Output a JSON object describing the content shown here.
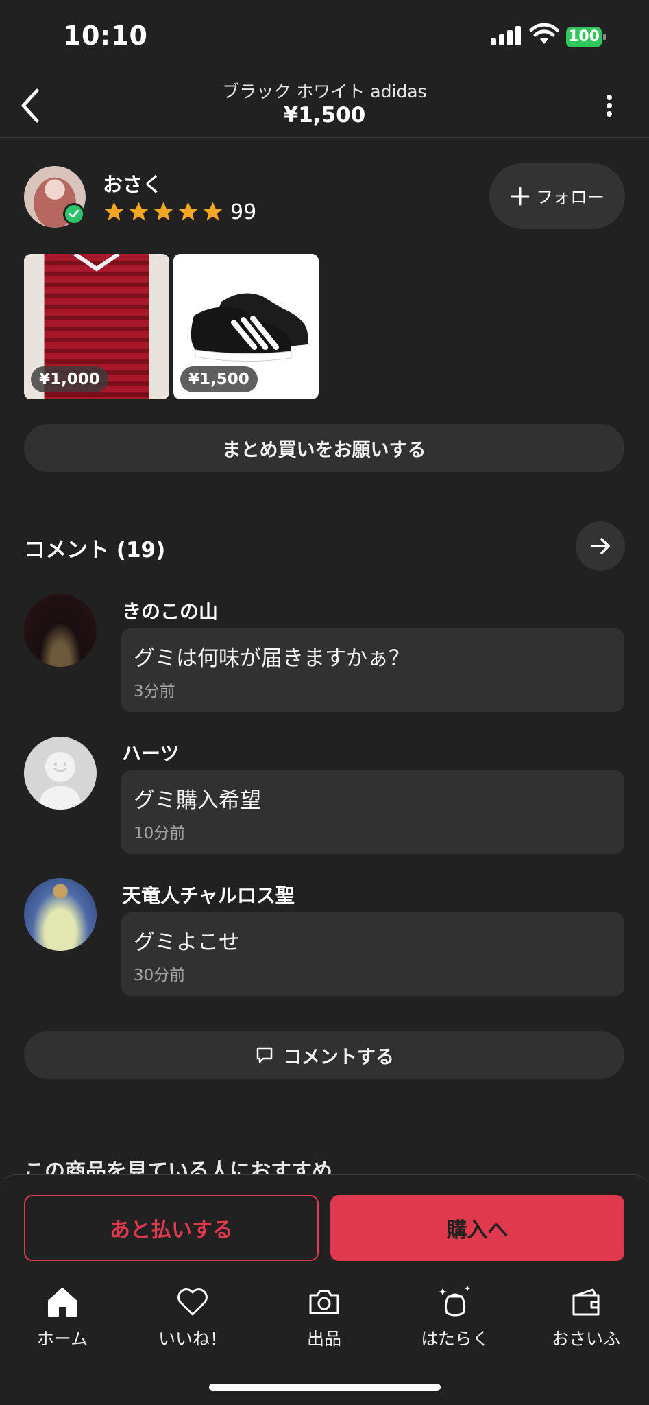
{
  "status_bar": {
    "time": "10:10",
    "battery": "100"
  },
  "header": {
    "title": "ブラック ホワイト adidas",
    "price": "¥1,500"
  },
  "seller": {
    "name": "おさく",
    "rating_stars": 5,
    "rating_count": "99",
    "follow_label": "フォロー"
  },
  "other_items": [
    {
      "price": "¥1,000",
      "icon": "red-polo-shirt"
    },
    {
      "price": "¥1,500",
      "icon": "black-white-sneakers"
    }
  ],
  "bundle_button": "まとめ買いをお願いする",
  "comments": {
    "heading": "コメント (19)",
    "items": [
      {
        "name": "きのこの山",
        "text": "グミは何味が届きますかぁ？",
        "time": "3分前"
      },
      {
        "name": "ハーツ",
        "text": "グミ購入希望",
        "time": "10分前"
      },
      {
        "name": "天竜人チャルロス聖",
        "text": "グミよこせ",
        "time": "30分前"
      }
    ],
    "comment_button": "コメントする"
  },
  "recommend_heading": "この商品を見ている人におすすめ",
  "actions": {
    "pay_later": "あと払いする",
    "purchase": "購入へ"
  },
  "tabs": [
    {
      "label": "ホーム",
      "icon": "home-icon"
    },
    {
      "label": "いいね！",
      "icon": "heart-icon"
    },
    {
      "label": "出品",
      "icon": "camera-icon"
    },
    {
      "label": "はたらく",
      "icon": "work-bag-icon"
    },
    {
      "label": "おさいふ",
      "icon": "wallet-icon"
    }
  ],
  "colors": {
    "background": "#212121",
    "accent": "#e0394e",
    "star": "#f5a623",
    "verified": "#2ec26a",
    "battery": "#30c85a"
  }
}
